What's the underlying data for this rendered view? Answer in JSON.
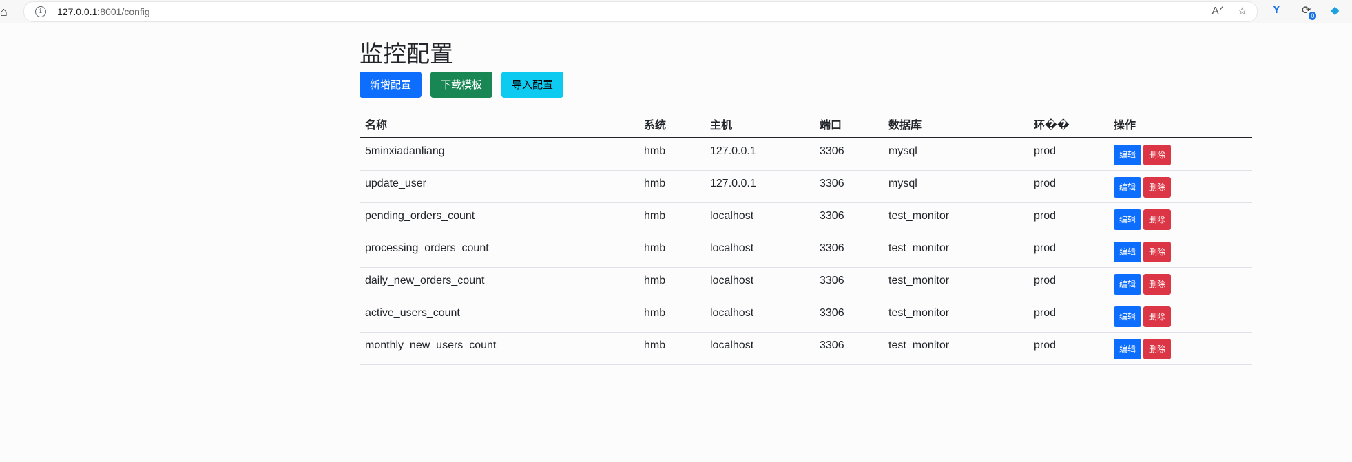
{
  "browser": {
    "url_host": "127.0.0.1",
    "url_rest": ":8001/config",
    "sync_badge": "0"
  },
  "page": {
    "title": "监控配置",
    "buttons": {
      "add": "新增配置",
      "download": "下载模板",
      "import": "导入配置"
    }
  },
  "table": {
    "headers": [
      "名称",
      "系统",
      "主机",
      "端口",
      "数据库",
      "环��",
      "操作"
    ],
    "rows": [
      {
        "name": "5minxiadanliang",
        "system": "hmb",
        "host": "127.0.0.1",
        "port": "3306",
        "db": "mysql",
        "env": "prod"
      },
      {
        "name": "update_user",
        "system": "hmb",
        "host": "127.0.0.1",
        "port": "3306",
        "db": "mysql",
        "env": "prod"
      },
      {
        "name": "pending_orders_count",
        "system": "hmb",
        "host": "localhost",
        "port": "3306",
        "db": "test_monitor",
        "env": "prod"
      },
      {
        "name": "processing_orders_count",
        "system": "hmb",
        "host": "localhost",
        "port": "3306",
        "db": "test_monitor",
        "env": "prod"
      },
      {
        "name": "daily_new_orders_count",
        "system": "hmb",
        "host": "localhost",
        "port": "3306",
        "db": "test_monitor",
        "env": "prod"
      },
      {
        "name": "active_users_count",
        "system": "hmb",
        "host": "localhost",
        "port": "3306",
        "db": "test_monitor",
        "env": "prod"
      },
      {
        "name": "monthly_new_users_count",
        "system": "hmb",
        "host": "localhost",
        "port": "3306",
        "db": "test_monitor",
        "env": "prod"
      }
    ],
    "edit_label": "编辑",
    "delete_label": "删除"
  },
  "colors": {
    "primary": "#0d6efd",
    "success": "#198754",
    "info": "#0dcaf0",
    "danger": "#dc3545"
  },
  "icons": [
    "home-icon",
    "info-icon",
    "read-aloud-icon",
    "favorite-star-icon",
    "extension-y-icon",
    "sync-icon",
    "copilot-icon"
  ]
}
